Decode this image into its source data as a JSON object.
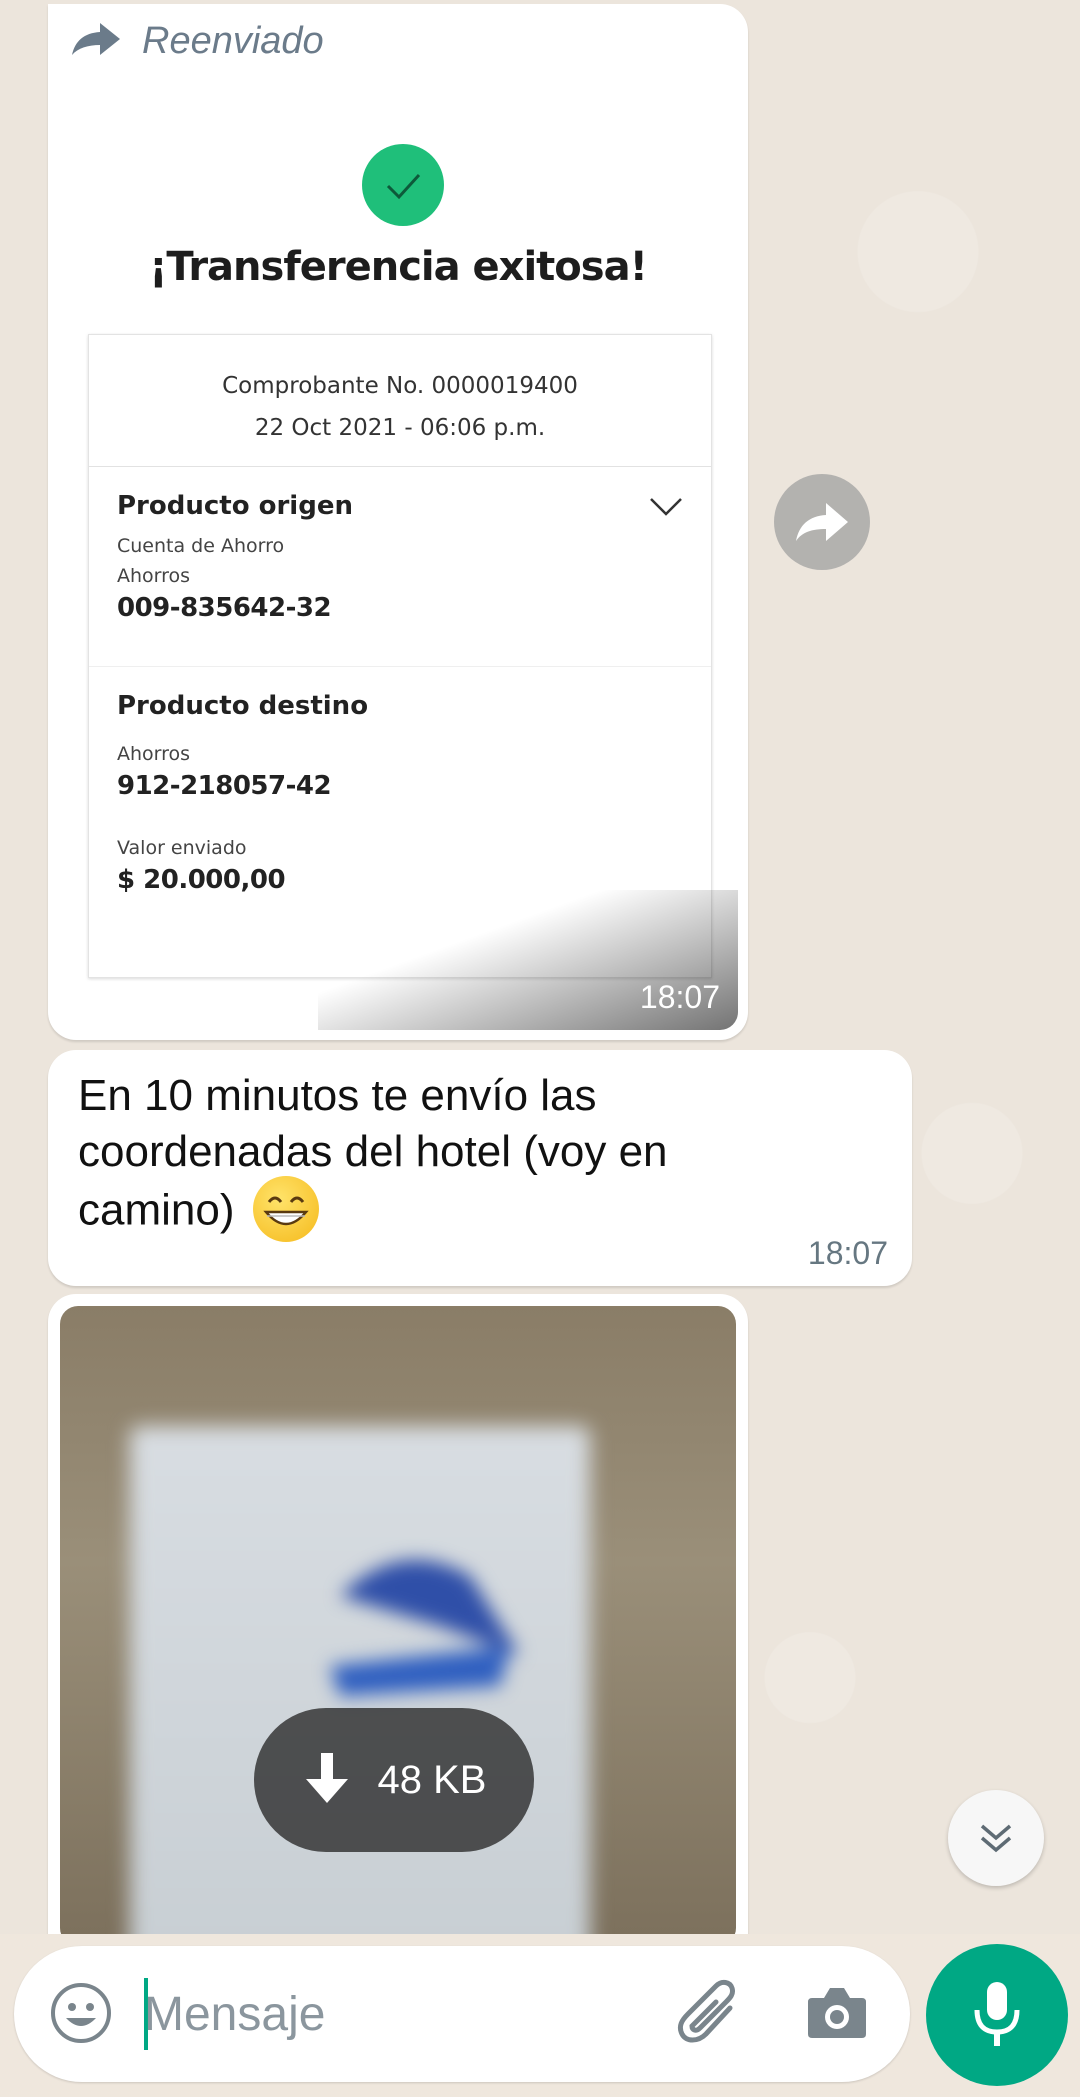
{
  "forwarded_message": {
    "forwarded_label": "Reenviado",
    "time": "18:07",
    "receipt": {
      "title": "¡Transferencia exitosa!",
      "receipt_number": "Comprobante No. 0000019400",
      "datetime": "22 Oct 2021 - 06:06 p.m.",
      "origin": {
        "heading": "Producto origen",
        "account_type": "Cuenta de Ahorro",
        "subtype": "Ahorros",
        "account_number": "009-835642-32"
      },
      "destination": {
        "heading": "Producto destino",
        "subtype": "Ahorros",
        "account_number": "912-218057-42",
        "amount_label": "Valor enviado",
        "amount": "$ 20.000,00"
      }
    }
  },
  "text_message": {
    "text": "En 10 minutos te envío las coordenadas del hotel (voy en camino)",
    "emoji": "grinning-face-with-smiling-eyes",
    "time": "18:07"
  },
  "image_message": {
    "download_size": "48 KB"
  },
  "composer": {
    "placeholder": "Mensaje"
  },
  "colors": {
    "accent": "#00a884",
    "bubble": "#ffffff",
    "wallpaper": "#efe7dd",
    "success": "#1fbf7a"
  }
}
